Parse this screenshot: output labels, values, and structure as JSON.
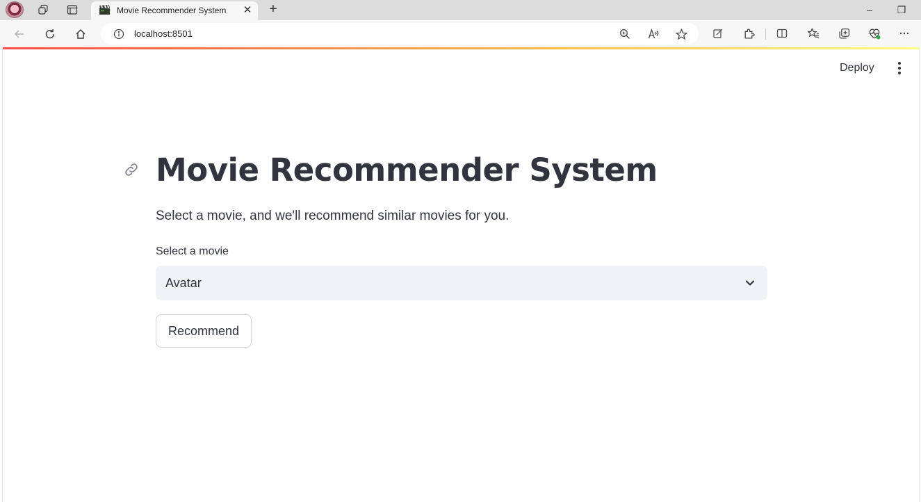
{
  "browser": {
    "tab": {
      "title": "Movie Recommender System",
      "favicon": "clapperboard-icon"
    },
    "address": "localhost:8501",
    "window_controls": {
      "minimize": "–",
      "restore": "❐"
    }
  },
  "app": {
    "header": {
      "deploy_label": "Deploy",
      "menu_icon": "kebab-menu-icon"
    },
    "title": "Movie Recommender System",
    "subtitle": "Select a movie, and we'll recommend similar movies for you.",
    "select": {
      "label": "Select a movie",
      "value": "Avatar"
    },
    "button": {
      "label": "Recommend"
    },
    "colors": {
      "accent_gradient": [
        "#ff4b4b",
        "#ffbd45",
        "#fffd80"
      ],
      "text": "#31333f",
      "input_bg": "#f0f2f6"
    }
  }
}
